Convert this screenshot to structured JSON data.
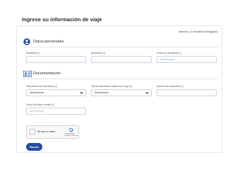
{
  "page": {
    "title": "Ingrese su información de viaje"
  },
  "form": {
    "required_note": "Atención: (*) Información Obligatoria",
    "personal_section": {
      "title": "Datos personales",
      "icon": "user-circle-icon",
      "fields": {
        "first_name": {
          "label": "Nombre(s) (*)",
          "value": ""
        },
        "last_name": {
          "label": "Apellido(s) (*)",
          "value": ""
        },
        "birth_date": {
          "label": "Fecha de nacimiento (*)",
          "placeholder": "dd/mm/yyyy"
        }
      }
    },
    "documents_section": {
      "title": "Documentación",
      "icon": "id-card-icon",
      "fields": {
        "issuing_country": {
          "label": "País emisor del documento (*)",
          "selected": "Seleccionar"
        },
        "document_type": {
          "label": "Tipo de documento usado en el viaje (*)",
          "selected": "Seleccionar"
        },
        "document_number": {
          "label": "Número de documento (*)",
          "value": ""
        },
        "last_transit_date": {
          "label": "Fecha del último tránsito (*)",
          "placeholder": "dd/mm/yyyy"
        }
      }
    },
    "captcha": {
      "label": "No soy un robot",
      "brand": "reCAPTCHA",
      "terms": "Privacidad - Condiciones"
    },
    "submit_label": "Buscar"
  },
  "colors": {
    "primary": "#1f4e9c",
    "field_border": "#c9d3de",
    "card_border": "#e4e7ec"
  }
}
